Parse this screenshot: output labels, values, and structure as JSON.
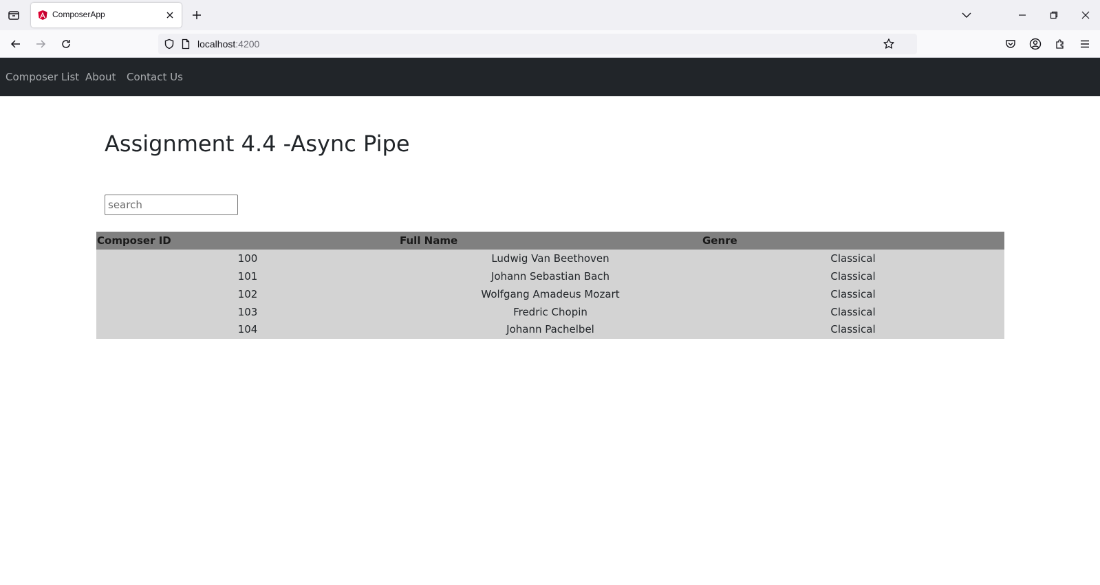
{
  "browser": {
    "tab_title": "ComposerApp",
    "url_host": "localhost",
    "url_port": ":4200"
  },
  "nav": {
    "items": [
      {
        "label": "Composer List"
      },
      {
        "label": "About"
      },
      {
        "label": "Contact Us"
      }
    ]
  },
  "page": {
    "title": "Assignment 4.4 -Async Pipe",
    "search_placeholder": "search"
  },
  "table": {
    "headers": [
      "Composer ID",
      "Full Name",
      "Genre"
    ],
    "rows": [
      [
        "100",
        "Ludwig Van Beethoven",
        "Classical"
      ],
      [
        "101",
        "Johann Sebastian Bach",
        "Classical"
      ],
      [
        "102",
        "Wolfgang Amadeus Mozart",
        "Classical"
      ],
      [
        "103",
        "Fredric Chopin",
        "Classical"
      ],
      [
        "104",
        "Johann Pachelbel",
        "Classical"
      ]
    ]
  },
  "colors": {
    "navbar_bg": "#212529",
    "table_header_bg": "#808080",
    "table_row_bg": "#d3d3d3"
  },
  "icons": [
    "tab-list-icon",
    "angular-favicon-icon",
    "close-icon",
    "plus-icon",
    "chevron-down-icon",
    "minimize-icon",
    "restore-icon",
    "window-close-icon",
    "back-arrow-icon",
    "forward-arrow-icon",
    "reload-icon",
    "shield-icon",
    "page-icon",
    "star-icon",
    "pocket-icon",
    "account-icon",
    "extensions-icon",
    "menu-icon"
  ]
}
